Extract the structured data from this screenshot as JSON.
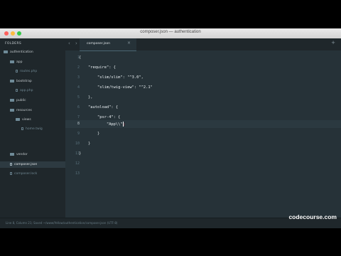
{
  "window": {
    "title": "composer.json — authentication"
  },
  "sidebar": {
    "header": "FOLDERS",
    "items": [
      {
        "label": "authentication",
        "type": "folder"
      },
      {
        "label": "app",
        "type": "folder"
      },
      {
        "label": "routes.php",
        "type": "file"
      },
      {
        "label": "bootstrap",
        "type": "folder"
      },
      {
        "label": "app.php",
        "type": "file"
      },
      {
        "label": "public",
        "type": "folder"
      },
      {
        "label": "resources",
        "type": "folder"
      },
      {
        "label": "views",
        "type": "folder"
      },
      {
        "label": "home.twig",
        "type": "file"
      },
      {
        "label": "vendor",
        "type": "folder"
      },
      {
        "label": "composer.json",
        "type": "file",
        "active": true
      },
      {
        "label": "composer.lock",
        "type": "file"
      }
    ]
  },
  "tabbar": {
    "prev": "‹",
    "next": "›",
    "add": "+"
  },
  "tab": {
    "label": "composer.json",
    "close": "×"
  },
  "editor": {
    "line_numbers": [
      "1",
      "2",
      "3",
      "4",
      "5",
      "6",
      "7",
      "8",
      "9",
      "10",
      "11",
      "12",
      "13"
    ],
    "current_line": "8",
    "lines": [
      "{",
      "    \"require\": {",
      "        \"slim/slim\": \"^3.0\",",
      "        \"slim/twig-view\": \"^2.1\"",
      "    },",
      "    \"autoload\": {",
      "        \"psr-4\": {",
      "            \"App\\\\\"",
      "        }",
      "    }",
      "}",
      "",
      ""
    ],
    "cursor_trail": ";"
  },
  "statusbar": {
    "text": "Line 8, Column 21; Saved ~/www/Yellow/authentication/composer.json (UTF-8)"
  },
  "brand": "codecourse.com"
}
